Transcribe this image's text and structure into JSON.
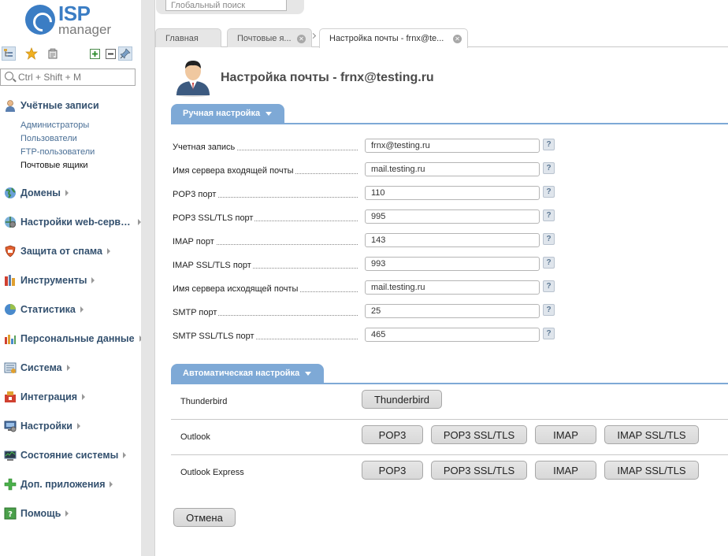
{
  "logo": {
    "brand": "ISP",
    "product": "manager"
  },
  "sidebar": {
    "search_placeholder": "Ctrl + Shift + M",
    "groups": [
      {
        "label": "Учётные записи",
        "icon": "user-accounts-icon",
        "color": "#c98a4a",
        "items": [
          "Администраторы",
          "Пользователи",
          "FTP-пользователи",
          "Почтовые ящики"
        ],
        "current": 3
      },
      {
        "label": "Домены",
        "icon": "globe-icon",
        "color": "#5a8fc6"
      },
      {
        "label": "Настройки web-серв…",
        "icon": "web-server-icon",
        "color": "#5a9a5a"
      },
      {
        "label": "Защита от спама",
        "icon": "shield-icon",
        "color": "#d05a2a"
      },
      {
        "label": "Инструменты",
        "icon": "tools-icon",
        "color": "#c94a3a"
      },
      {
        "label": "Статистика",
        "icon": "pie-chart-icon",
        "color": "#4a8acb"
      },
      {
        "label": "Персональные данные",
        "icon": "bar-chart-icon",
        "color": "#d08a2a"
      },
      {
        "label": "Система",
        "icon": "system-icon",
        "color": "#6a8aa8"
      },
      {
        "label": "Интеграция",
        "icon": "integration-icon",
        "color": "#c94a3a"
      },
      {
        "label": "Настройки",
        "icon": "monitor-settings-icon",
        "color": "#4a6fa0"
      },
      {
        "label": "Состояние системы",
        "icon": "system-status-icon",
        "color": "#5a7a9a"
      },
      {
        "label": "Доп. приложения",
        "icon": "plus-icon",
        "color": "#3aa03a"
      },
      {
        "label": "Помощь",
        "icon": "help-book-icon",
        "color": "#4aa04a"
      }
    ]
  },
  "global_search": {
    "placeholder": "Глобальный поиск"
  },
  "tabs": [
    {
      "label": "Главная"
    },
    {
      "label": "Почтовые я..."
    },
    {
      "label": "Настройка почты - frnx@te..."
    }
  ],
  "page": {
    "title": "Настройка почты - frnx@testing.ru",
    "manual_section": "Ручная настройка",
    "fields": [
      {
        "label": "Учетная запись",
        "value": "frnx@testing.ru"
      },
      {
        "label": "Имя сервера входящей почты",
        "value": "mail.testing.ru"
      },
      {
        "label": "POP3 порт",
        "value": "110"
      },
      {
        "label": "POP3 SSL/TLS порт",
        "value": "995"
      },
      {
        "label": "IMAP порт",
        "value": "143"
      },
      {
        "label": "IMAP SSL/TLS порт",
        "value": "993"
      },
      {
        "label": "Имя сервера исходящей почты",
        "value": "mail.testing.ru"
      },
      {
        "label": "SMTP порт",
        "value": "25"
      },
      {
        "label": "SMTP SSL/TLS порт",
        "value": "465"
      }
    ],
    "help_glyph": "?",
    "auto_section": "Автоматическая настройка",
    "auto_rows": [
      {
        "label": "Thunderbird",
        "buttons": [
          "Thunderbird"
        ]
      },
      {
        "label": "Outlook",
        "buttons": [
          "POP3",
          "POP3 SSL/TLS",
          "IMAP",
          "IMAP SSL/TLS"
        ]
      },
      {
        "label": "Outlook Express",
        "buttons": [
          "POP3",
          "POP3 SSL/TLS",
          "IMAP",
          "IMAP SSL/TLS"
        ]
      }
    ],
    "cancel_label": "Отмена"
  }
}
